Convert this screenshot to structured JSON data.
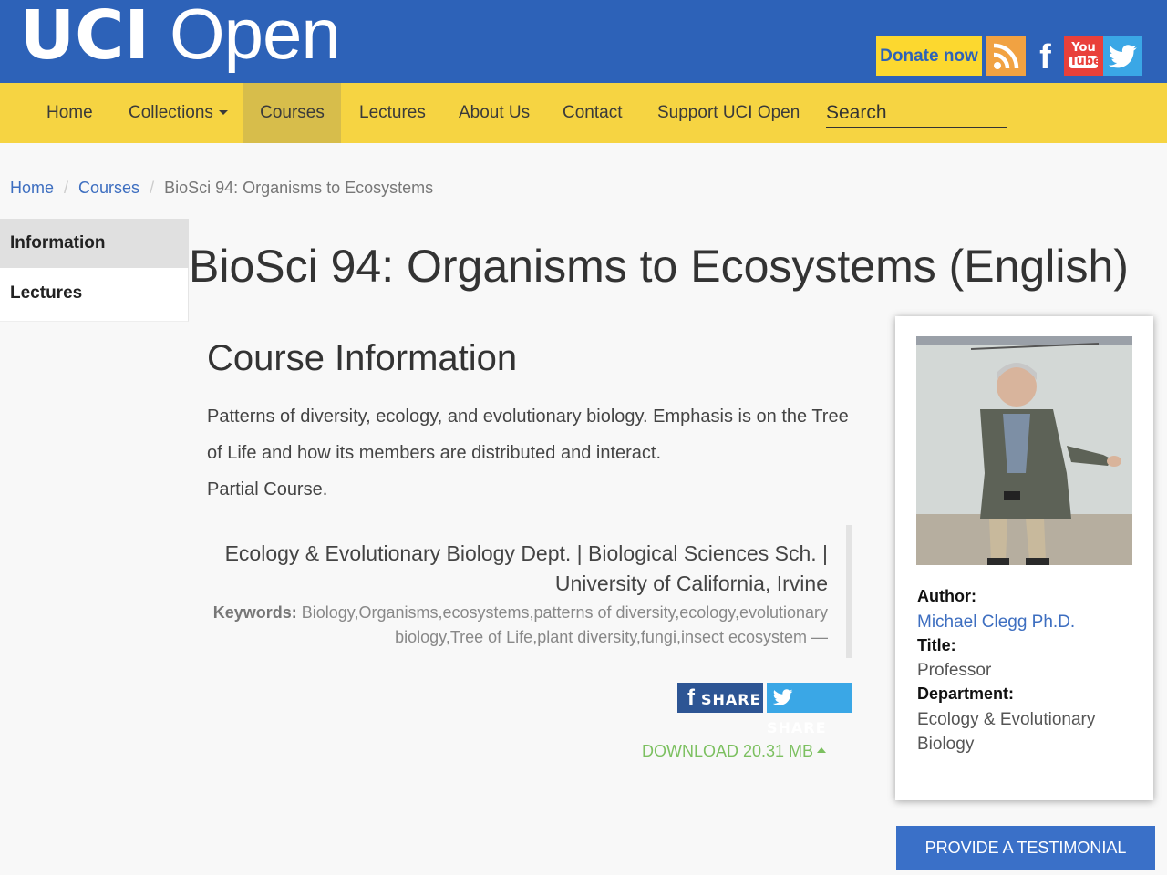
{
  "header": {
    "logo_bold": "UCI",
    "logo_light": "Open",
    "donate_label": "Donate now",
    "social": [
      "rss-icon",
      "facebook-icon",
      "youtube-icon",
      "twitter-icon"
    ],
    "youtube_text_top": "You",
    "youtube_text_bottom": "Tube",
    "facebook_glyph": "f"
  },
  "nav": {
    "items": [
      {
        "label": "Home"
      },
      {
        "label": "Collections"
      },
      {
        "label": "Courses"
      },
      {
        "label": "Lectures"
      },
      {
        "label": "About Us"
      },
      {
        "label": "Contact"
      },
      {
        "label": "Support UCI Open"
      }
    ],
    "active": "Courses",
    "search_placeholder": "Search"
  },
  "breadcrumb": {
    "home": "Home",
    "courses": "Courses",
    "current": "BioSci 94: Organisms to Ecosystems",
    "separator": "/"
  },
  "sidenav": {
    "items": [
      {
        "label": "Information",
        "active": true
      },
      {
        "label": "Lectures",
        "active": false
      }
    ]
  },
  "main": {
    "page_title": "BioSci 94: Organisms to Ecosystems (English)",
    "section_title": "Course Information",
    "description": "Patterns of diversity, ecology, and evolutionary biology. Emphasis is on the Tree of Life and how its members are distributed and interact.",
    "note": "Partial Course.",
    "institution_line1": "Ecology & Evolutionary Biology Dept. | Biological Sciences Sch. |",
    "institution_line2": "University of California, Irvine",
    "keywords_label": "Keywords:",
    "keywords_line1": "Biology,Organisms,ecosystems,patterns of diversity,ecology,evolutionary",
    "keywords_line2": "biology,Tree of Life,plant diversity,fungi,insect ecosystem —",
    "share_fb_label": "SHARE",
    "share_tw_label": "SHARE",
    "download_label": "DOWNLOAD 20.31 MB"
  },
  "author_card": {
    "author_label": "Author:",
    "author_name": "Michael Clegg Ph.D.",
    "title_label": "Title:",
    "title_value": "Professor",
    "department_label": "Department:",
    "department_line1": "Ecology & Evolutionary",
    "department_line2": "Biology"
  },
  "testimonial_label": "PROVIDE A TESTIMONIAL",
  "colors": {
    "header_blue": "#2d62b8",
    "nav_yellow": "#f6d442",
    "nav_active": "#d7bd4b",
    "donate_yellow": "#fcd82f",
    "link_blue": "#3d6ec0",
    "download_green": "#7cc060",
    "button_blue": "#3a70c8"
  }
}
